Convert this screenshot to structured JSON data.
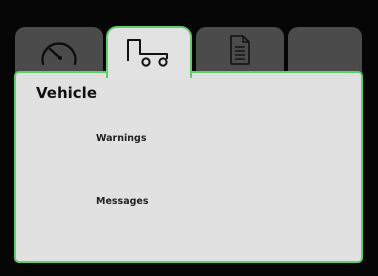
{
  "tabs": [
    {
      "icon": "speedometer-icon",
      "selected": false
    },
    {
      "icon": "vehicle-trailer-icon",
      "selected": true
    },
    {
      "icon": "document-icon",
      "selected": false
    },
    {
      "icon": "",
      "selected": false
    }
  ],
  "panel": {
    "title": "Vehicle",
    "items": [
      {
        "label": "Warnings"
      },
      {
        "label": "Messages"
      }
    ]
  },
  "colors": {
    "accent": "#5fce6d",
    "panel_bg": "#e1e1e1",
    "tab_bg": "#4b4b4b",
    "screen_bg": "#060606"
  }
}
